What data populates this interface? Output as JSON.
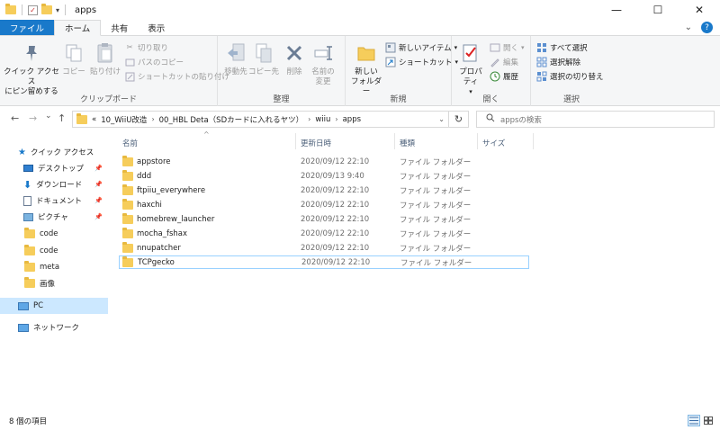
{
  "window": {
    "title": "apps",
    "controls": {
      "minimize": "—",
      "maximize": "☐",
      "close": "✕"
    }
  },
  "ribbon_tabs": [
    "ファイル",
    "ホーム",
    "共有",
    "表示"
  ],
  "ribbon": {
    "clipboard": {
      "label": "クリップボード",
      "pin": "クイック アクセス\nにピン留めする",
      "copy": "コピー",
      "paste": "貼り付け",
      "cut": "切り取り",
      "copy_path": "パスのコピー",
      "paste_shortcut": "ショートカットの貼り付け"
    },
    "organize": {
      "label": "整理",
      "move_to": "移動先",
      "copy_to": "コピー先",
      "delete": "削除",
      "rename": "名前の\n変更"
    },
    "new": {
      "label": "新規",
      "new_folder": "新しい\nフォルダー",
      "new_item": "新しいアイテム",
      "shortcut": "ショートカット"
    },
    "open": {
      "label": "開く",
      "properties": "プロパティ",
      "open": "開く",
      "edit": "編集",
      "history": "履歴"
    },
    "select": {
      "label": "選択",
      "select_all": "すべて選択",
      "select_none": "選択解除",
      "invert": "選択の切り替え"
    }
  },
  "address": {
    "overflow": "«",
    "segments": [
      "10_WiiU改造",
      "00_HBL Deta（SDカードに入れるヤツ）",
      "wiiu",
      "apps"
    ],
    "refresh": "↻"
  },
  "search": {
    "placeholder": "appsの検索"
  },
  "nav": {
    "back": "←",
    "forward": "→",
    "recent": "⌄",
    "up": "↑"
  },
  "navpane": {
    "quick_access": "クイック アクセス",
    "items": [
      {
        "label": "デスクトップ",
        "pinned": true
      },
      {
        "label": "ダウンロード",
        "pinned": true
      },
      {
        "label": "ドキュメント",
        "pinned": true
      },
      {
        "label": "ピクチャ",
        "pinned": true
      },
      {
        "label": "code",
        "pinned": false
      },
      {
        "label": "code",
        "pinned": false
      },
      {
        "label": "meta",
        "pinned": false
      },
      {
        "label": "画像",
        "pinned": false
      }
    ],
    "pc": "PC",
    "network": "ネットワーク"
  },
  "columns": {
    "name": "名前",
    "date": "更新日時",
    "type": "種類",
    "size": "サイズ"
  },
  "files": [
    {
      "name": "appstore",
      "date": "2020/09/12 22:10",
      "type": "ファイル フォルダー"
    },
    {
      "name": "ddd",
      "date": "2020/09/13 9:40",
      "type": "ファイル フォルダー"
    },
    {
      "name": "ftpiiu_everywhere",
      "date": "2020/09/12 22:10",
      "type": "ファイル フォルダー"
    },
    {
      "name": "haxchi",
      "date": "2020/09/12 22:10",
      "type": "ファイル フォルダー"
    },
    {
      "name": "homebrew_launcher",
      "date": "2020/09/12 22:10",
      "type": "ファイル フォルダー"
    },
    {
      "name": "mocha_fshax",
      "date": "2020/09/12 22:10",
      "type": "ファイル フォルダー"
    },
    {
      "name": "nnupatcher",
      "date": "2020/09/12 22:10",
      "type": "ファイル フォルダー"
    },
    {
      "name": "TCPgecko",
      "date": "2020/09/12 22:10",
      "type": "ファイル フォルダー"
    }
  ],
  "status": {
    "count": "8 個の項目"
  },
  "colors": {
    "accent": "#1979ca",
    "selection": "#cce8ff",
    "folder": "#f6cd5b"
  }
}
